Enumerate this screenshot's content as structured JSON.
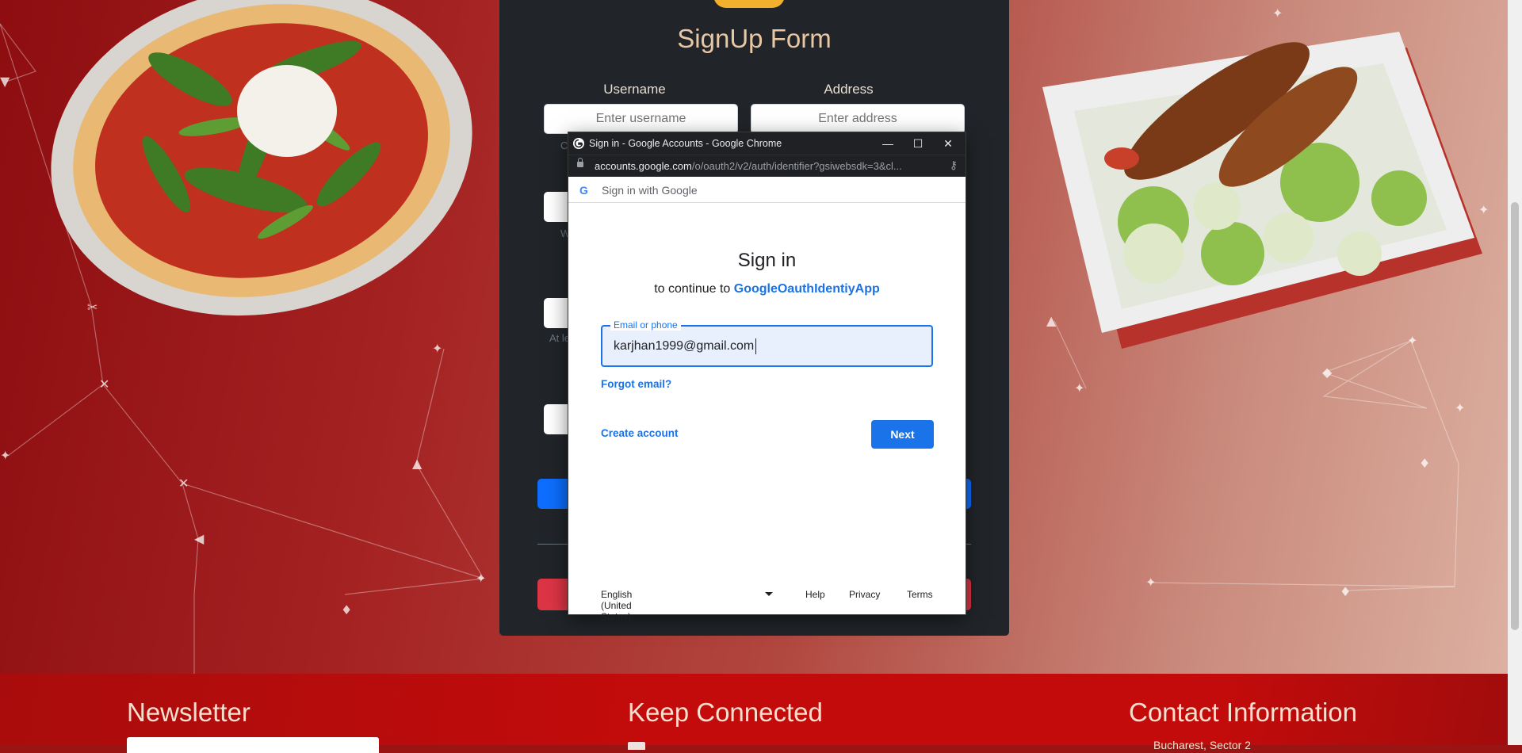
{
  "form": {
    "title": "SignUp Form",
    "username_label": "Username",
    "username_placeholder": "Enter username",
    "address_label": "Address",
    "address_placeholder": "Enter address",
    "hint_fragments": [
      "C",
      "W",
      "At le"
    ]
  },
  "popup": {
    "window_title": "Sign in - Google Accounts - Google Chrome",
    "url_host": "accounts.google.com",
    "url_path": "/o/oauth2/v2/auth/identifier?gsiwebsdk=3&cl...",
    "header_label": "Sign in with Google",
    "title": "Sign in",
    "subtitle_prefix": "to continue to ",
    "app_name": "GoogleOauthIdentiyApp",
    "email_label": "Email or phone",
    "email_value": "karjhan1999@gmail.com",
    "forgot_email": "Forgot email?",
    "create_account": "Create account",
    "next": "Next",
    "language": "English (United States)",
    "help": "Help",
    "privacy": "Privacy",
    "terms": "Terms"
  },
  "footer": {
    "newsletter_title": "Newsletter",
    "keep_connected_title": "Keep Connected",
    "contact_title": "Contact Information",
    "contact_first_line": "Bucharest, Sector 2"
  },
  "colors": {
    "google_blue": "#1a73e8",
    "form_bg": "#212529",
    "primary_button": "#0d6efd",
    "danger_button": "#dc3545",
    "footer_red": "#c40b0b"
  }
}
